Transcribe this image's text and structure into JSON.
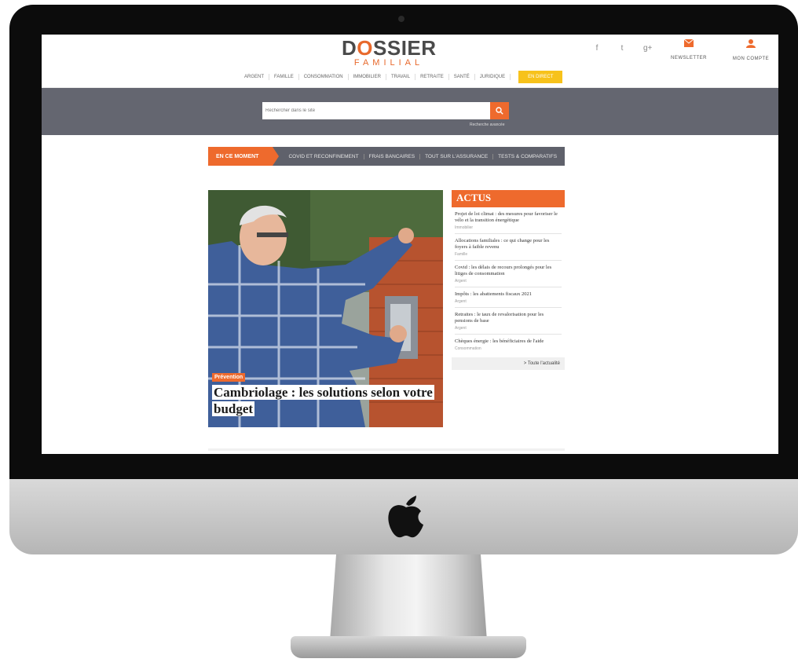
{
  "header": {
    "logo_line1_pre": "D",
    "logo_line1_o": "O",
    "logo_line1_post": "SSIER",
    "logo_line2": "FAMILIAL",
    "social": [
      "f",
      "t",
      "g+"
    ],
    "newsletter_label": "NEWSLETTER",
    "account_label": "MON COMPTE"
  },
  "nav": {
    "items": [
      "ARGENT",
      "FAMILLE",
      "CONSOMMATION",
      "IMMOBILIER",
      "TRAVAIL",
      "RETRAITE",
      "SANTÉ",
      "JURIDIQUE"
    ],
    "cta_label": "EN DIRECT"
  },
  "search": {
    "placeholder": "Rechercher dans le site",
    "advanced_label": "Recherche avancée"
  },
  "trending": {
    "label": "EN CE MOMENT",
    "items": [
      "COVID ET RECONFINEMENT",
      "FRAIS BANCAIRES",
      "TOUT SUR L'ASSURANCE",
      "TESTS & COMPARATIFS"
    ]
  },
  "hero": {
    "tag": "Prévention",
    "title": "Cambriolage : les solutions selon votre budget"
  },
  "actus": {
    "title": "ACTUS",
    "items": [
      {
        "title": "Projet de loi climat : des mesures pour favoriser le vélo et la transition énergétique",
        "category": "Immobilier"
      },
      {
        "title": "Allocations familiales : ce qui change pour les foyers à faible revenu",
        "category": "Famille"
      },
      {
        "title": "Covid : les délais de recours prolongés pour les litiges de consommation",
        "category": "Argent"
      },
      {
        "title": "Impôts : les abattements fiscaux 2021",
        "category": "Argent"
      },
      {
        "title": "Retraites : le taux de revalorisation pour les pensions de base",
        "category": "Argent"
      },
      {
        "title": "Chèques énergie : les bénéficiaires de l'aide",
        "category": "Consommation"
      }
    ],
    "more_label": "> Toute l'actualité"
  },
  "colors": {
    "accent": "#ee6a2d",
    "band": "#646670",
    "cta": "#f7c21b"
  }
}
